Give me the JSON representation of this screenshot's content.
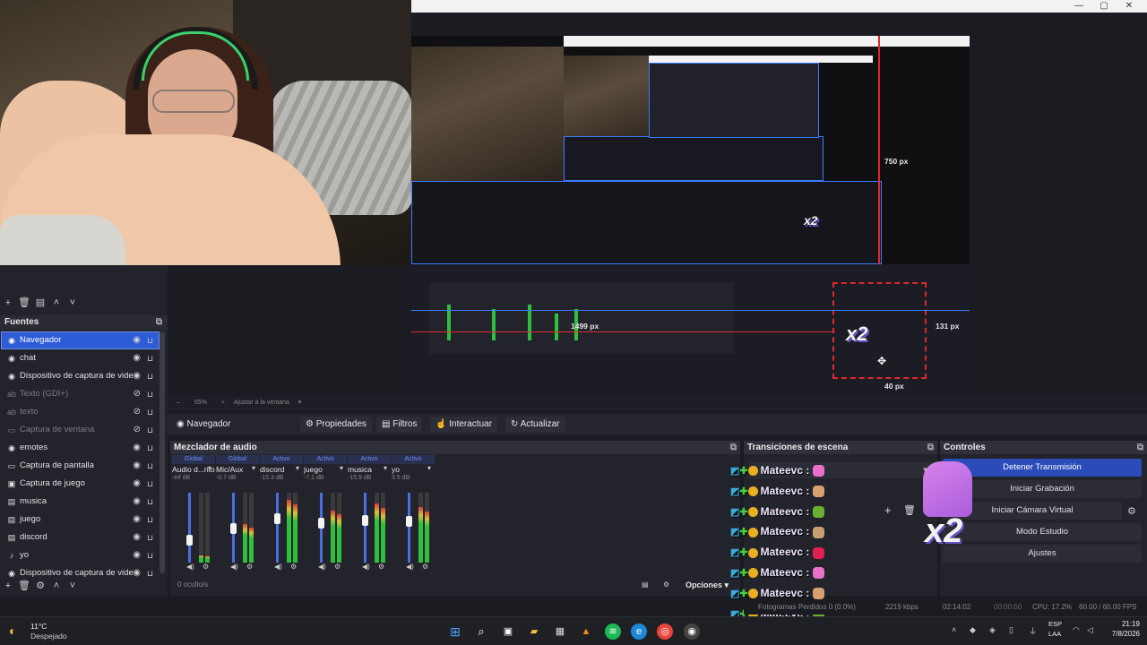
{
  "window": {
    "min": "—",
    "max": "▢",
    "close": "✕"
  },
  "docks": {
    "fuentes": "Fuentes",
    "mixer": "Mezclador de audio",
    "transitions": "Transiciones de escena",
    "controls": "Controles"
  },
  "sources": [
    {
      "icon": "globe-icon",
      "glyph": "◉",
      "label": "Navegador",
      "selected": true
    },
    {
      "icon": "globe-icon",
      "glyph": "◉",
      "label": "chat"
    },
    {
      "icon": "camera-icon",
      "glyph": "◉",
      "label": "Dispositivo de captura de vide"
    },
    {
      "icon": "text-icon",
      "glyph": "ab",
      "label": "Texto (GDI+)",
      "dim": true
    },
    {
      "icon": "text-icon",
      "glyph": "ab",
      "label": "texto",
      "dim": true
    },
    {
      "icon": "window-icon",
      "glyph": "▭",
      "label": "Captura de ventana",
      "dim": true
    },
    {
      "icon": "globe-icon",
      "glyph": "◉",
      "label": "emotes"
    },
    {
      "icon": "monitor-icon",
      "glyph": "▭",
      "label": "Captura de pantalla"
    },
    {
      "icon": "gamepad-icon",
      "glyph": "▣",
      "label": "Captura de juego"
    },
    {
      "icon": "speaker-icon",
      "glyph": "▤",
      "label": "musica"
    },
    {
      "icon": "speaker-icon",
      "glyph": "▤",
      "label": "juego"
    },
    {
      "icon": "speaker-icon",
      "glyph": "▤",
      "label": "discord"
    },
    {
      "icon": "mic-icon",
      "glyph": "♪",
      "label": "yo"
    },
    {
      "icon": "camera-icon",
      "glyph": "◉",
      "label": "Dispositivo de captura de vide"
    }
  ],
  "preview": {
    "zoom": "55%",
    "fit": "Ajustar a la ventana",
    "dim_right": "750 px",
    "dim_mid": "1499 px",
    "dim_small": "131 px",
    "dim_bottom": "40 px"
  },
  "context": {
    "source": "Navegador",
    "props": "Propiedades",
    "filters": "Filtros",
    "interact": "Interactuar",
    "refresh": "Actualizar"
  },
  "mixer": {
    "channels": [
      {
        "name": "Audio d...ritorio",
        "db": "-inf dB",
        "global": "Global",
        "level": 0.1
      },
      {
        "name": "Mic/Aux",
        "db": "-0.7 dB",
        "global": "Global",
        "level": 0.55
      },
      {
        "name": "discord",
        "db": "-15.3 dB",
        "global": "Activo",
        "level": 0.9
      },
      {
        "name": "juego",
        "db": "-7.1 dB",
        "global": "Activo",
        "level": 0.75
      },
      {
        "name": "musica",
        "db": "-15.9 dB",
        "global": "Activo",
        "level": 0.85
      },
      {
        "name": "yo",
        "db": "3.5 dB",
        "global": "Activo",
        "level": 0.8
      }
    ],
    "hidden": "0 oculto/s",
    "options": "Opciones"
  },
  "controls": {
    "stop_stream": "Detener Transmisión",
    "start_record": "Iniciar Grabación",
    "virtual_cam": "Iniciar Cámara Virtual",
    "studio": "Modo Estudio",
    "settings": "Ajustes"
  },
  "chat": {
    "user": "Mateevc :",
    "emote_colors": [
      "#e870c8",
      "#d8a070",
      "#6ab030",
      "#c8a070",
      "#e02050",
      "#e870c8",
      "#d8a070",
      "#6ab030",
      "#c8a070"
    ]
  },
  "status": {
    "dropped": "Fotogramas Perdidos 0 (0.0%)",
    "kbps": "2219 kbps",
    "time": "02:14:02",
    "rec": "00:00:00",
    "cpu": "CPU: 17.2%",
    "fps": "60.00 / 60.00 FPS"
  },
  "taskbar": {
    "temp": "11°C",
    "weather": "Despejado",
    "lang1": "ESP",
    "lang2": "LAA",
    "time": "21:19",
    "date": "7/8/2026"
  },
  "emote_x2": "x2",
  "colors": {
    "accent": "#2e5bd6",
    "stream_active": "#2b4bb8",
    "guide_red": "#e0282c",
    "guide_blue": "#3a7bff"
  }
}
